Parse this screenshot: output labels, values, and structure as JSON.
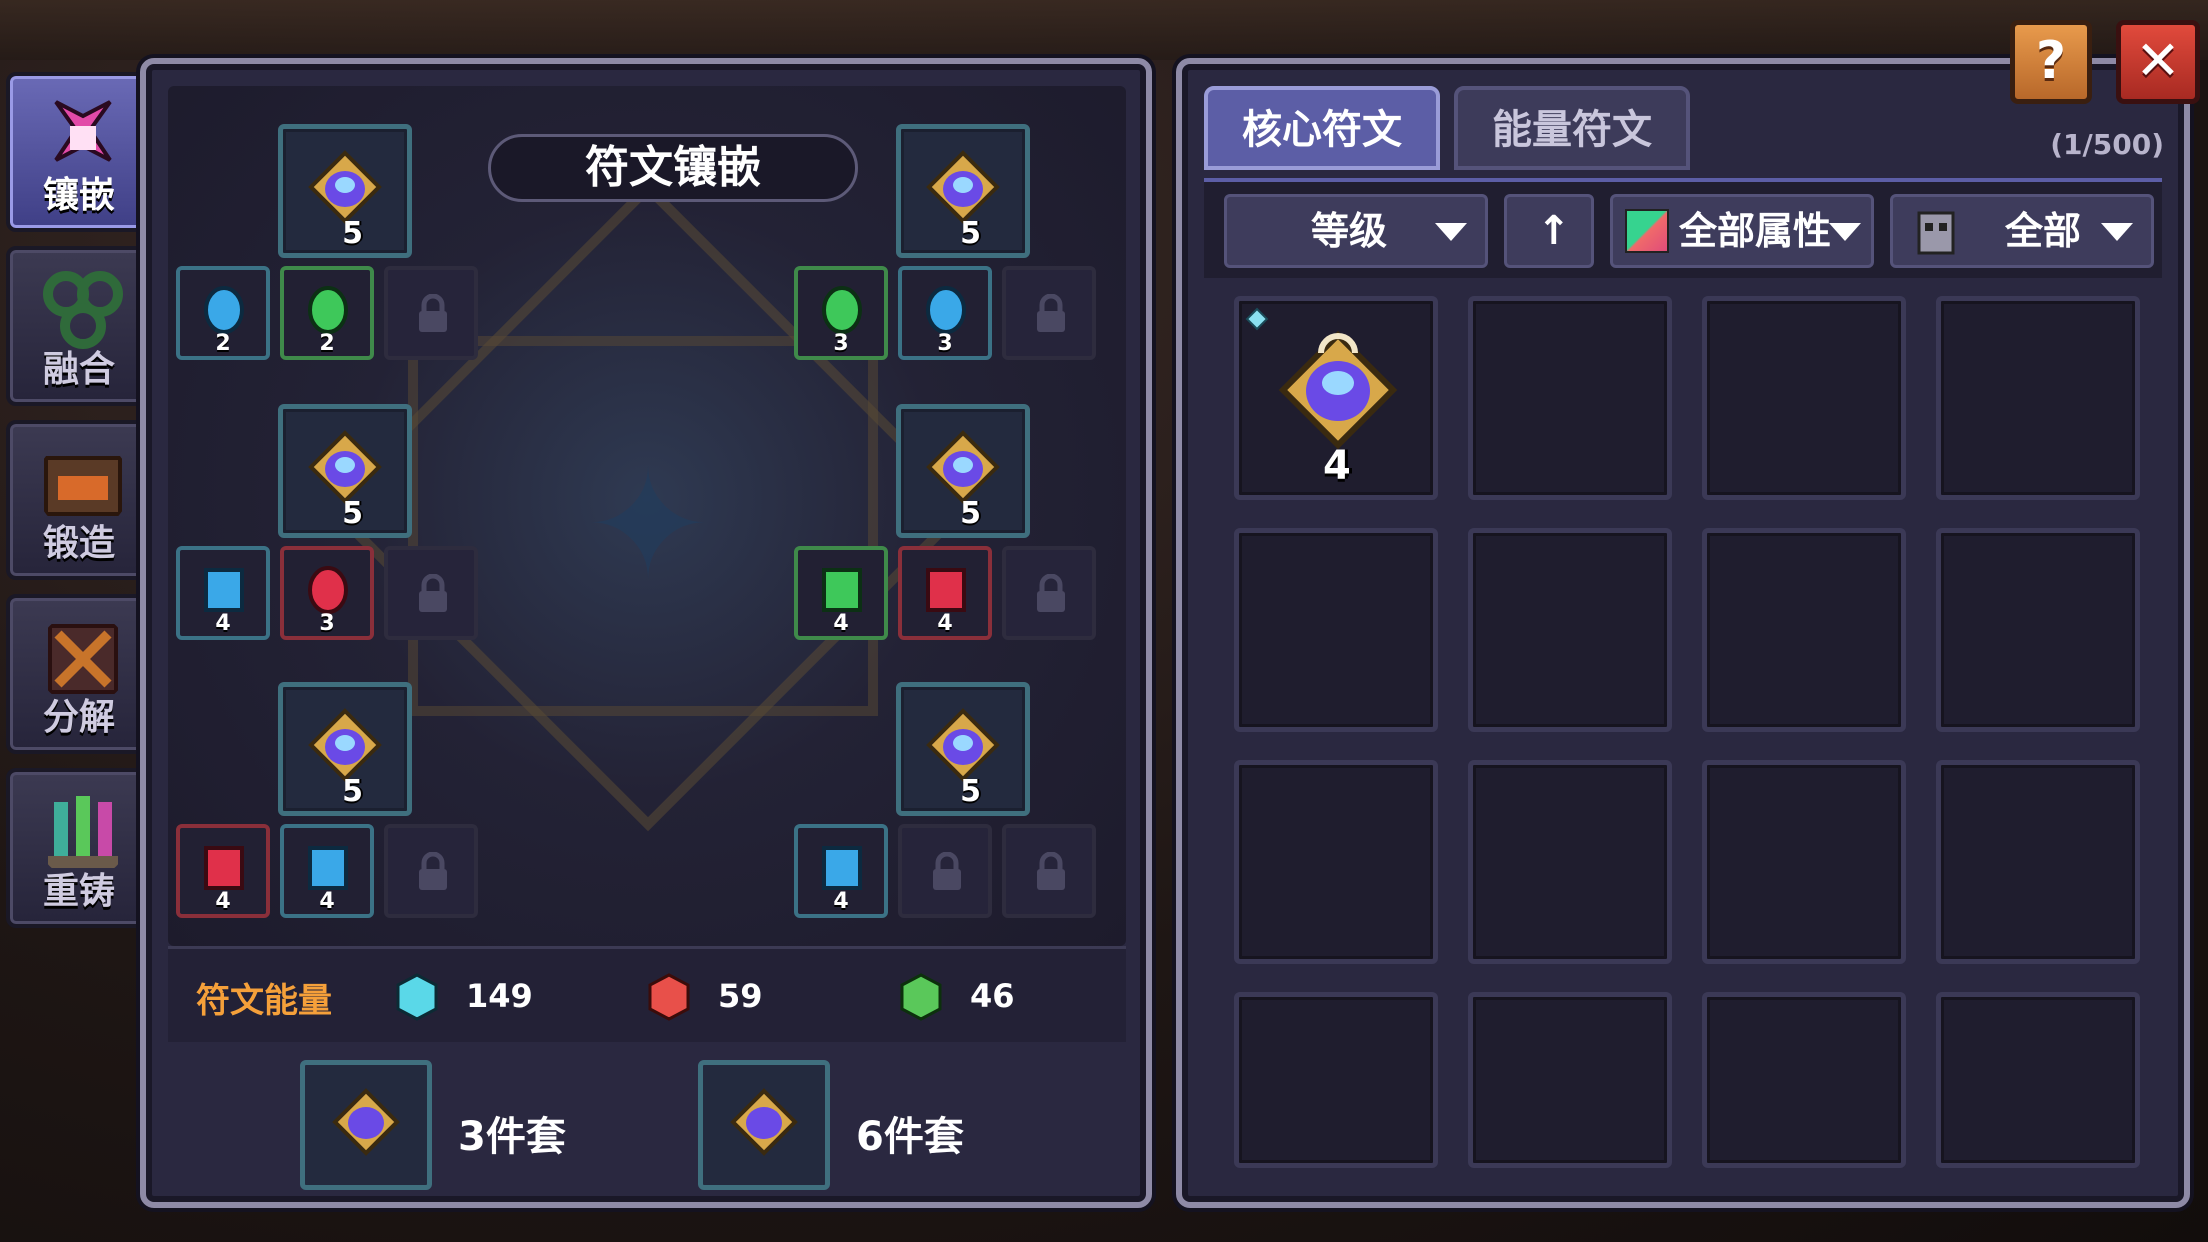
{
  "nav": {
    "items": [
      {
        "label": "镶嵌",
        "icon": "inlay-icon",
        "active": true
      },
      {
        "label": "融合",
        "icon": "fusion-icon",
        "active": false
      },
      {
        "label": "锻造",
        "icon": "forge-icon",
        "active": false
      },
      {
        "label": "分解",
        "icon": "decompose-icon",
        "active": false
      },
      {
        "label": "重铸",
        "icon": "recast-icon",
        "active": false
      }
    ]
  },
  "board": {
    "title": "符文镶嵌",
    "core_slots": [
      {
        "level": "5"
      },
      {
        "level": "5"
      },
      {
        "level": "5"
      },
      {
        "level": "5"
      },
      {
        "level": "5"
      },
      {
        "level": "5"
      }
    ],
    "energy_slots": [
      {
        "level": "2",
        "color": "blue"
      },
      {
        "level": "2",
        "color": "green"
      },
      {
        "level": "3",
        "color": "green"
      },
      {
        "level": "3",
        "color": "blue"
      },
      {
        "level": "4",
        "color": "blue"
      },
      {
        "level": "3",
        "color": "red"
      },
      {
        "level": "4",
        "color": "green"
      },
      {
        "level": "4",
        "color": "red"
      },
      {
        "level": "4",
        "color": "red"
      },
      {
        "level": "4",
        "color": "blue"
      },
      {
        "level": "4",
        "color": "blue"
      }
    ]
  },
  "energy": {
    "title": "符文能量",
    "blue": "149",
    "red": "59",
    "green": "46"
  },
  "sets": {
    "set3_label": "3件套",
    "set6_label": "6件套"
  },
  "inventory": {
    "tabs": [
      "核心符文",
      "能量符文"
    ],
    "counter": "(1/500)",
    "sort_label": "等级",
    "attr_label": "全部属性",
    "type_label": "全部",
    "items": [
      {
        "level": "4"
      }
    ]
  },
  "colors": {
    "accent": "#5c5ea6",
    "energy_title": "#f5a03a",
    "close": "#e14a3c",
    "help": "#e89a4c"
  }
}
